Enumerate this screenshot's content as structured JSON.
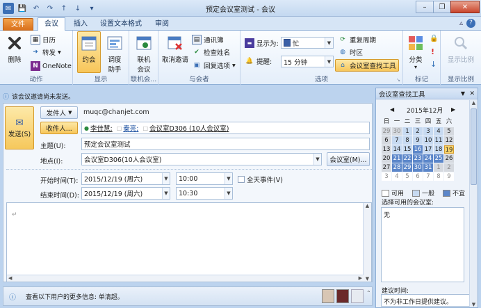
{
  "window": {
    "title": "预定会议室测试 - 会议",
    "minimize": "–",
    "restore": "❐",
    "close": "✕"
  },
  "ribbon_tabs": [
    "文件",
    "会议",
    "插入",
    "设置文本格式",
    "审阅"
  ],
  "groups": {
    "actions": {
      "label": "动作",
      "delete": "删除",
      "calendar": "日历",
      "forward": "转发",
      "onenote": "OneNote"
    },
    "show": {
      "label": "显示",
      "meeting": "约会",
      "scheduling": "调度助手"
    },
    "meeting_notes": {
      "label": "联机会...",
      "online_meeting": "联机会议"
    },
    "attendees": {
      "label": "与会者",
      "cancel_invitation": "取消邀请",
      "address_book": "通讯簿",
      "check_names": "检查姓名",
      "response_options": "回复选项"
    },
    "options": {
      "label": "选项",
      "show_as_label": "显示为:",
      "show_as_value": "忙",
      "reminder_label": "提醒:",
      "reminder_value": "15 分钟",
      "recurrence": "重复周期",
      "time_zones": "时区",
      "room_finder": "会议室查找工具"
    },
    "tags": {
      "label": "标记",
      "categorize": "分类"
    },
    "zoom": {
      "label": "显示比例",
      "zoom": "显示比例"
    }
  },
  "form": {
    "info": "该会议邀请尚未发送。",
    "send": "发送(S)",
    "from_button": "发件人",
    "from_value": "muqc@chanjet.com",
    "to_button": "收件人...",
    "to_recipients": [
      "李佳慧;",
      "秦亮;",
      "会议室D306 (10人会议室)"
    ],
    "subject_label": "主题(U):",
    "subject_value": "预定会议室测试",
    "location_label": "地点(I):",
    "location_value": "会议室D306(10人会议室)",
    "rooms_button": "会议室(M)...",
    "start_label": "开始时间(T):",
    "start_date": "2015/12/19 (周六)",
    "start_time": "10:00",
    "all_day": "全天事件(V)",
    "end_label": "结束时间(D):",
    "end_date": "2015/12/19 (周六)",
    "end_time": "10:30",
    "body_mark": "↵"
  },
  "status": {
    "text": "查看以下用户的更多信息: 单清超。"
  },
  "finder": {
    "title": "会议室查找工具",
    "month": "2015年12月",
    "weekdays": [
      "日",
      "一",
      "二",
      "三",
      "四",
      "五",
      "六"
    ],
    "weeks": [
      [
        "29",
        "30",
        "1",
        "2",
        "3",
        "4",
        "5"
      ],
      [
        "6",
        "7",
        "8",
        "9",
        "10",
        "11",
        "12"
      ],
      [
        "13",
        "14",
        "15",
        "16",
        "17",
        "18",
        "19"
      ],
      [
        "20",
        "21",
        "22",
        "23",
        "24",
        "25",
        "26"
      ],
      [
        "27",
        "28",
        "29",
        "30",
        "31",
        "1",
        "2"
      ],
      [
        "3",
        "4",
        "5",
        "6",
        "7",
        "8",
        "9"
      ]
    ],
    "legend_available": "可用",
    "legend_fair": "一般",
    "legend_poor": "不宜",
    "choose_rooms_label": "选择可用的会议室:",
    "rooms_value": "无",
    "suggested_label": "建议时间:",
    "suggested_value": "不为非工作日提供建议。"
  }
}
